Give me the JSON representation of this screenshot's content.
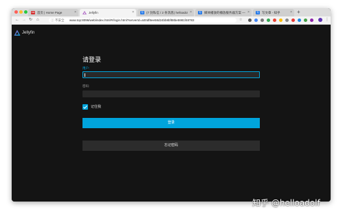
{
  "browser": {
    "tabs": [
      {
        "title": "首页 | Home Page",
        "favicon_color": "#d32f2f",
        "favicon_text": "OM"
      },
      {
        "title": "Jellyfin",
        "favicon_color": "#9b59b6",
        "favicon_text": ""
      },
      {
        "title": "(7 封私信 / 2 条消息) helloadolf",
        "favicon_color": "#1a73e8",
        "favicon_text": "知"
      },
      {
        "title": "媒体播放的播放服务器方案 — 知",
        "favicon_color": "#1a73e8",
        "favicon_text": "知"
      },
      {
        "title": "写文章 - 知乎",
        "favicon_color": "#1a73e8",
        "favicon_text": "知"
      }
    ],
    "active_tab_index": 1,
    "new_tab_symbol": "+",
    "close_symbol": "×",
    "address": {
      "security_label": "不安全",
      "url": "www.top:8096/web/index.html#!/login.html?serverId=a00df8ee58d24bb8bf88be5981f48783"
    }
  },
  "app": {
    "logo_text": "Jellyfin",
    "login": {
      "title": "请登录",
      "username_label": "用户:",
      "username_value": "",
      "password_label": "密码:",
      "password_value": "",
      "remember_label": "记住我",
      "remember_checked": true,
      "submit_label": "登录",
      "forgot_label": "忘记密码"
    }
  },
  "watermark": "知乎 @helloadolf",
  "colors": {
    "accent": "#00a4dc",
    "background": "#141414",
    "input_background": "#292929",
    "secondary_button": "#2c2c2c"
  }
}
